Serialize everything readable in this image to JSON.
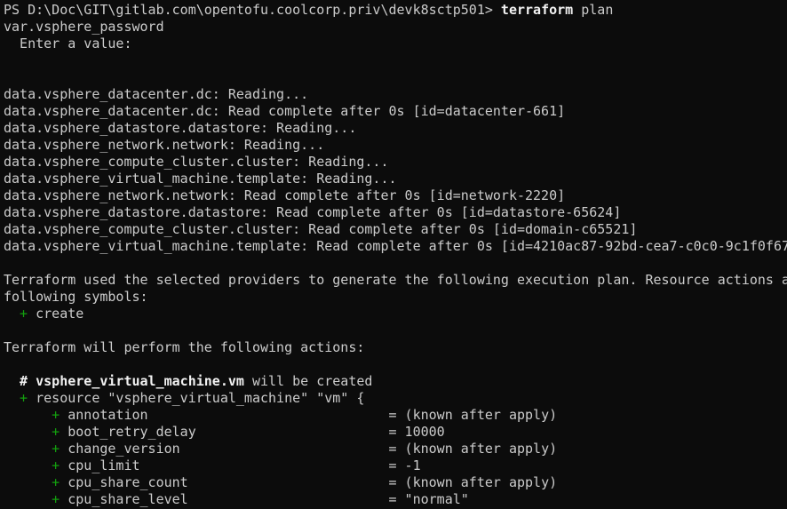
{
  "terminal": {
    "prompt": "PS D:\\Doc\\GIT\\gitlab.com\\opentofu.coolcorp.priv\\devk8sctp501> ",
    "command_bold": "terraform",
    "command_rest": " plan",
    "var_name": "var.vsphere_password",
    "var_prompt": "  Enter a value:",
    "reads": [
      "data.vsphere_datacenter.dc: Reading...",
      "data.vsphere_datacenter.dc: Read complete after 0s [id=datacenter-661]",
      "data.vsphere_datastore.datastore: Reading...",
      "data.vsphere_network.network: Reading...",
      "data.vsphere_compute_cluster.cluster: Reading...",
      "data.vsphere_virtual_machine.template: Reading...",
      "data.vsphere_network.network: Read complete after 0s [id=network-2220]",
      "data.vsphere_datastore.datastore: Read complete after 0s [id=datastore-65624]",
      "data.vsphere_compute_cluster.cluster: Read complete after 0s [id=domain-c65521]",
      "data.vsphere_virtual_machine.template: Read complete after 0s [id=4210ac87-92bd-cea7-c0c0-9c1f0f67"
    ],
    "providers_line1": "Terraform used the selected providers to generate the following execution plan. Resource actions a",
    "providers_line2": "following symbols:",
    "create_plus": "  + ",
    "create_word": "create",
    "actions_line": "Terraform will perform the following actions:",
    "comment_hash": "  # ",
    "comment_resource": "vsphere_virtual_machine.vm",
    "comment_rest": " will be created",
    "resource_plus": "  + ",
    "resource_decl": "resource \"vsphere_virtual_machine\" \"vm\" {",
    "attributes": [
      {
        "plus": "      + ",
        "name": "annotation                              ",
        "value": "= (known after apply)"
      },
      {
        "plus": "      + ",
        "name": "boot_retry_delay                        ",
        "value": "= 10000"
      },
      {
        "plus": "      + ",
        "name": "change_version                          ",
        "value": "= (known after apply)"
      },
      {
        "plus": "      + ",
        "name": "cpu_limit                               ",
        "value": "= -1"
      },
      {
        "plus": "      + ",
        "name": "cpu_share_count                         ",
        "value": "= (known after apply)"
      },
      {
        "plus": "      + ",
        "name": "cpu_share_level                         ",
        "value": "= \"normal\""
      }
    ]
  },
  "colors": {
    "background": "#0c0c0c",
    "text": "#cccccc",
    "plus": "#13a10e",
    "bold": "#f2f2f2"
  }
}
